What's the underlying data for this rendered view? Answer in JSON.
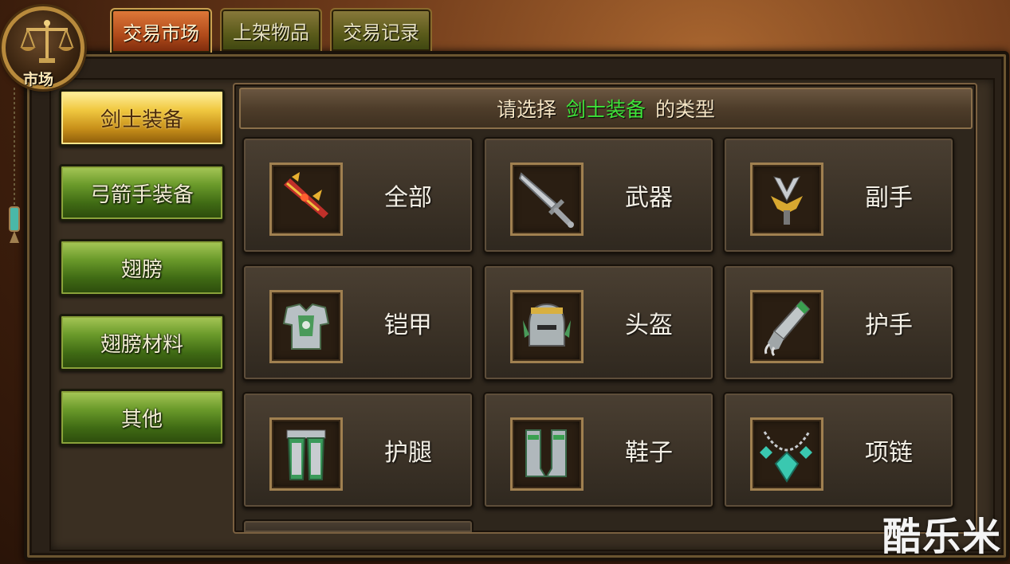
{
  "emblem": {
    "label": "市场",
    "icon": "scales-icon"
  },
  "tabs": [
    {
      "label": "交易市场",
      "active": true
    },
    {
      "label": "上架物品",
      "active": false
    },
    {
      "label": "交易记录",
      "active": false
    }
  ],
  "categories": [
    {
      "label": "剑士装备",
      "active": true
    },
    {
      "label": "弓箭手装备",
      "active": false
    },
    {
      "label": "翅膀",
      "active": false
    },
    {
      "label": "翅膀材料",
      "active": false
    },
    {
      "label": "其他",
      "active": false
    }
  ],
  "header": {
    "prefix": "请选择",
    "highlight": "剑士装备",
    "suffix": "的类型"
  },
  "types": [
    {
      "label": "全部",
      "icon": "all-items-icon"
    },
    {
      "label": "武器",
      "icon": "sword-icon"
    },
    {
      "label": "副手",
      "icon": "offhand-icon"
    },
    {
      "label": "铠甲",
      "icon": "armor-icon"
    },
    {
      "label": "头盔",
      "icon": "helmet-icon"
    },
    {
      "label": "护手",
      "icon": "gauntlet-icon"
    },
    {
      "label": "护腿",
      "icon": "leg-guard-icon"
    },
    {
      "label": "鞋子",
      "icon": "boots-icon"
    },
    {
      "label": "项链",
      "icon": "necklace-icon"
    }
  ],
  "colors": {
    "highlight_text": "#3ee43a",
    "active_tab": "#b04a1a",
    "active_category": "#f0c840",
    "category_button": "#6a9a2a"
  },
  "watermark": "酷乐米"
}
